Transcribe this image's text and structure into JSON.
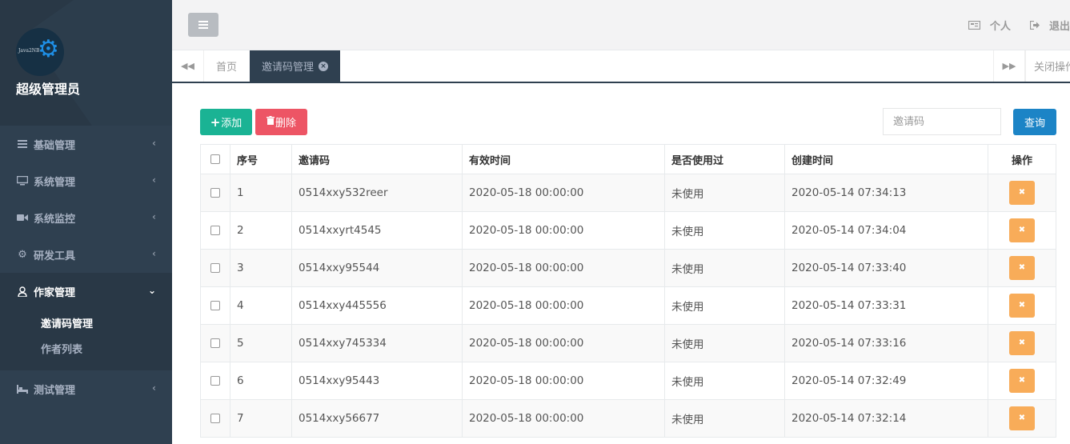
{
  "sidebar": {
    "logo_text": "Java2NB",
    "admin_name": "超级管理员",
    "items": [
      {
        "label": "基础管理",
        "icon": "list-icon"
      },
      {
        "label": "系统管理",
        "icon": "desktop-icon"
      },
      {
        "label": "系统监控",
        "icon": "video-camera-icon"
      },
      {
        "label": "研发工具",
        "icon": "gear-icon"
      },
      {
        "label": "作家管理",
        "icon": "user-icon"
      },
      {
        "label": "测试管理",
        "icon": "bed-icon"
      }
    ],
    "submenu": [
      "邀请码管理",
      "作者列表"
    ]
  },
  "topbar": {
    "profile_label": "个人",
    "logout_label": "退出"
  },
  "tabs": {
    "home": "首页",
    "active": "邀请码管理",
    "close_ops": "关闭操作"
  },
  "toolbar": {
    "add_label": "添加",
    "delete_label": "删除",
    "search_placeholder": "邀请码",
    "search_button": "查询"
  },
  "table": {
    "headers": [
      "序号",
      "邀请码",
      "有效时间",
      "是否使用过",
      "创建时间",
      "操作"
    ],
    "rows": [
      {
        "no": "1",
        "code": "0514xxy532reer",
        "valid": "2020-05-18 00:00:00",
        "used": "未使用",
        "created": "2020-05-14 07:34:13"
      },
      {
        "no": "2",
        "code": "0514xxyrt4545",
        "valid": "2020-05-18 00:00:00",
        "used": "未使用",
        "created": "2020-05-14 07:34:04"
      },
      {
        "no": "3",
        "code": "0514xxy95544",
        "valid": "2020-05-18 00:00:00",
        "used": "未使用",
        "created": "2020-05-14 07:33:40"
      },
      {
        "no": "4",
        "code": "0514xxy445556",
        "valid": "2020-05-18 00:00:00",
        "used": "未使用",
        "created": "2020-05-14 07:33:31"
      },
      {
        "no": "5",
        "code": "0514xxy745334",
        "valid": "2020-05-18 00:00:00",
        "used": "未使用",
        "created": "2020-05-14 07:33:16"
      },
      {
        "no": "6",
        "code": "0514xxy95443",
        "valid": "2020-05-18 00:00:00",
        "used": "未使用",
        "created": "2020-05-14 07:32:49"
      },
      {
        "no": "7",
        "code": "0514xxy56677",
        "valid": "2020-05-18 00:00:00",
        "used": "未使用",
        "created": "2020-05-14 07:32:14"
      }
    ]
  },
  "colors": {
    "sidebar_bg": "#2f4050",
    "add_green": "#1ab394",
    "delete_red": "#ed5565",
    "search_blue": "#1c84c6",
    "op_orange": "#f8ac59"
  }
}
